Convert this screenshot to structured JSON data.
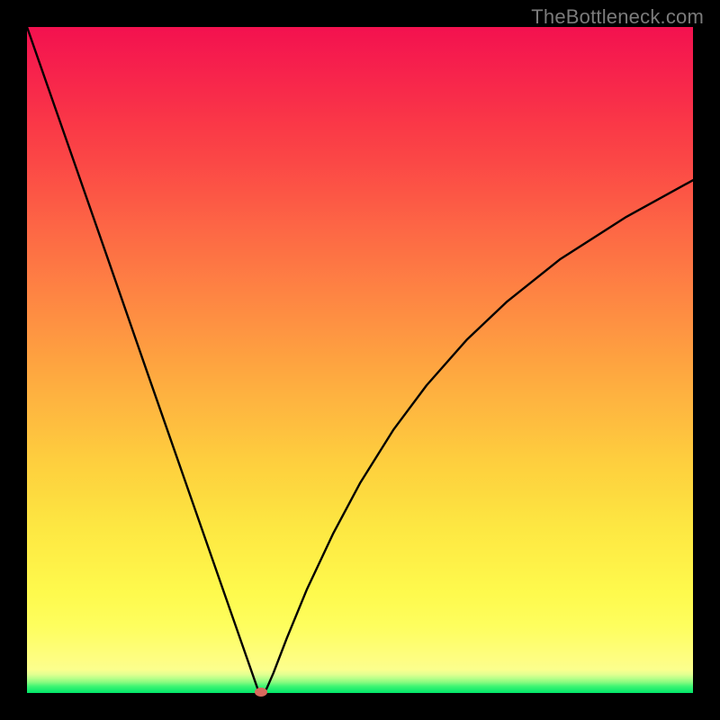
{
  "watermark": "TheBottleneck.com",
  "chart_data": {
    "type": "line",
    "title": "",
    "xlabel": "",
    "ylabel": "",
    "xlim": [
      0,
      100
    ],
    "ylim": [
      0,
      100
    ],
    "series": [
      {
        "name": "curve",
        "x": [
          0,
          6,
          12,
          18,
          24,
          30,
          33,
          34.8,
          35.5,
          36,
          37,
          39,
          42,
          46,
          50,
          55,
          60,
          66,
          72,
          80,
          90,
          100
        ],
        "y": [
          100,
          82.8,
          65.6,
          48.3,
          31.1,
          13.9,
          5.3,
          0.15,
          0.0,
          0.7,
          3.0,
          8.2,
          15.5,
          24.0,
          31.5,
          39.5,
          46.2,
          53.0,
          58.7,
          65.1,
          71.5,
          77.0
        ]
      }
    ],
    "marker": {
      "x": 35.2,
      "y": 0.1
    },
    "background_gradient": {
      "bottom": "#00e669",
      "mid": "#fefe5e",
      "top": "#f3114f"
    }
  }
}
